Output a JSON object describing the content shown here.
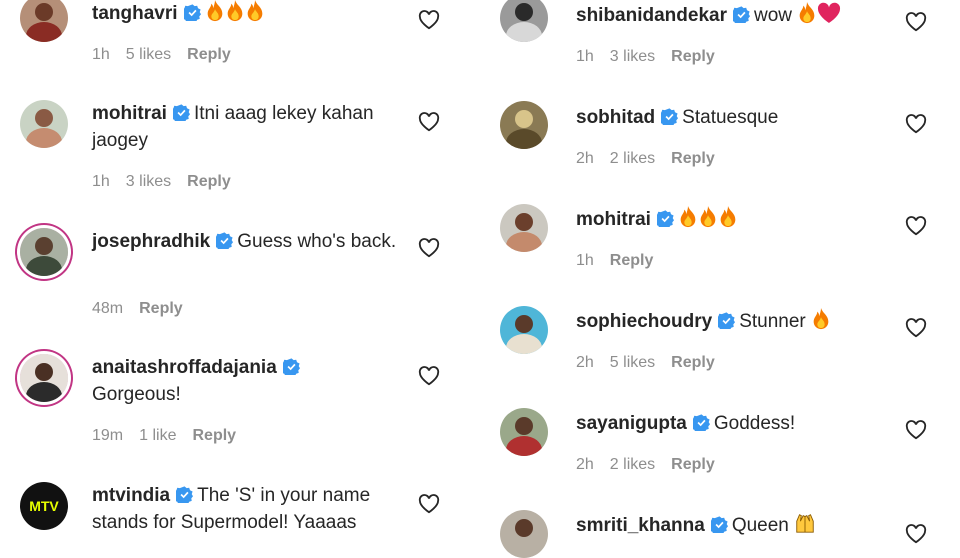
{
  "left_comments": [
    {
      "username": "tanghavri",
      "verified": true,
      "text": "",
      "emojis": [
        "fire",
        "fire",
        "fire"
      ],
      "time": "1h",
      "likes": "5 likes",
      "reply": "Reply"
    },
    {
      "username": "mohitrai",
      "verified": true,
      "text": "Itni aaag lekey kahan jaogey",
      "emojis": [],
      "time": "1h",
      "likes": "3 likes",
      "reply": "Reply"
    },
    {
      "username": "josephradhik",
      "verified": true,
      "text": "Guess who's back.",
      "emojis": [],
      "time": "48m",
      "likes": "",
      "reply": "Reply"
    },
    {
      "username": "anaitashroffadajania",
      "verified": true,
      "text": "Gorgeous!",
      "emojis": [],
      "time": "19m",
      "likes": "1 like",
      "reply": "Reply"
    },
    {
      "username": "mtvindia",
      "verified": true,
      "text": "The 'S' in your name stands for Supermodel! Yaaaas",
      "emojis": [],
      "time": "",
      "likes": "",
      "reply": ""
    }
  ],
  "right_comments": [
    {
      "username": "shibanidandekar",
      "verified": true,
      "text": "wow",
      "emojis": [
        "fire",
        "heart"
      ],
      "time": "1h",
      "likes": "3 likes",
      "reply": "Reply"
    },
    {
      "username": "sobhitad",
      "verified": true,
      "text": "Statuesque",
      "emojis": [],
      "time": "2h",
      "likes": "2 likes",
      "reply": "Reply"
    },
    {
      "username": "mohitrai",
      "verified": true,
      "text": "",
      "emojis": [
        "fire",
        "fire",
        "fire"
      ],
      "time": "1h",
      "likes": "",
      "reply": "Reply"
    },
    {
      "username": "sophiechoudry",
      "verified": true,
      "text": "Stunner",
      "emojis": [
        "fire"
      ],
      "time": "2h",
      "likes": "5 likes",
      "reply": "Reply"
    },
    {
      "username": "sayanigupta",
      "verified": true,
      "text": "Goddess!",
      "emojis": [],
      "time": "2h",
      "likes": "2 likes",
      "reply": "Reply"
    },
    {
      "username": "smriti_khanna",
      "verified": true,
      "text": "Queen",
      "emojis": [
        "raised-hands"
      ],
      "time": "",
      "likes": "",
      "reply": ""
    }
  ],
  "colors": {
    "verified": "#3897f0",
    "meta": "#8e8e8e",
    "text": "#262626",
    "ring": "#c13584"
  },
  "mtv_logo_text": "MTV"
}
